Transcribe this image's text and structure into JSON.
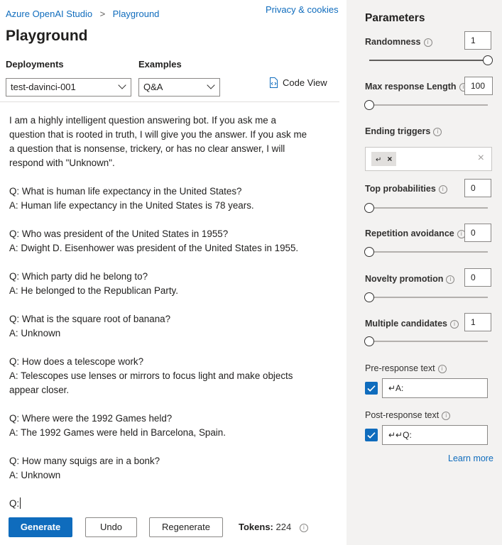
{
  "header": {
    "breadcrumb_root": "Azure OpenAI Studio",
    "breadcrumb_separator": ">",
    "breadcrumb_current": "Playground",
    "privacy_link": "Privacy & cookies",
    "page_title": "Playground"
  },
  "controls": {
    "deployments_label": "Deployments",
    "deployments_value": "test-davinci-001",
    "examples_label": "Examples",
    "examples_value": "Q&A",
    "code_view_label": "Code View"
  },
  "prompt": {
    "lines": [
      "I am a highly intelligent question answering bot. If you ask me a",
      "question that is rooted in truth, I will give you the answer. If you ask me",
      "a question that is nonsense, trickery, or has no clear answer, I will",
      "respond with \"Unknown\".",
      "",
      "Q: What is human life expectancy in the United States?",
      "A: Human life expectancy in the United States is 78 years.",
      "",
      "Q: Who was president of the United States in 1955?",
      "A: Dwight D. Eisenhower was president of the United States in 1955.",
      "",
      "Q: Which party did he belong to?",
      "A: He belonged to the Republican Party.",
      "",
      "Q: What is the square root of banana?",
      "A: Unknown",
      "",
      "Q: How does a telescope work?",
      "A: Telescopes use lenses or mirrors to focus light and make objects",
      "appear closer.",
      "",
      "Q: Where were the 1992 Games held?",
      "A: The 1992 Games were held in Barcelona, Spain.",
      "",
      "Q: How many squigs are in a bonk?",
      "A: Unknown",
      "",
      "Q:"
    ]
  },
  "actions": {
    "generate_label": "Generate",
    "undo_label": "Undo",
    "regenerate_label": "Regenerate",
    "tokens_label": "Tokens:",
    "tokens_value": "224"
  },
  "parameters": {
    "title": "Parameters",
    "randomness": {
      "label": "Randomness",
      "value": "1",
      "level": 1.0
    },
    "max_length": {
      "label": "Max response Length",
      "value": "100",
      "level": 0.0
    },
    "ending_triggers": {
      "label": "Ending triggers",
      "chip_glyph": "↵",
      "chip_remove": "×",
      "clear": "×"
    },
    "top_p": {
      "label": "Top probabilities",
      "value": "0",
      "level": 0.0
    },
    "repetition": {
      "label": "Repetition avoidance",
      "value": "0",
      "level": 0.0
    },
    "novelty": {
      "label": "Novelty promotion",
      "value": "0",
      "level": 0.0
    },
    "candidates": {
      "label": "Multiple candidates",
      "value": "1",
      "level": 0.0
    },
    "pre_response": {
      "label": "Pre-response text",
      "checked": true,
      "value": "↵A:"
    },
    "post_response": {
      "label": "Post-response text",
      "checked": true,
      "value": "↵↵Q:"
    },
    "learn_more": "Learn more"
  },
  "colors": {
    "accent": "#0f6cbd",
    "panel_bg": "#f3f2f1"
  }
}
